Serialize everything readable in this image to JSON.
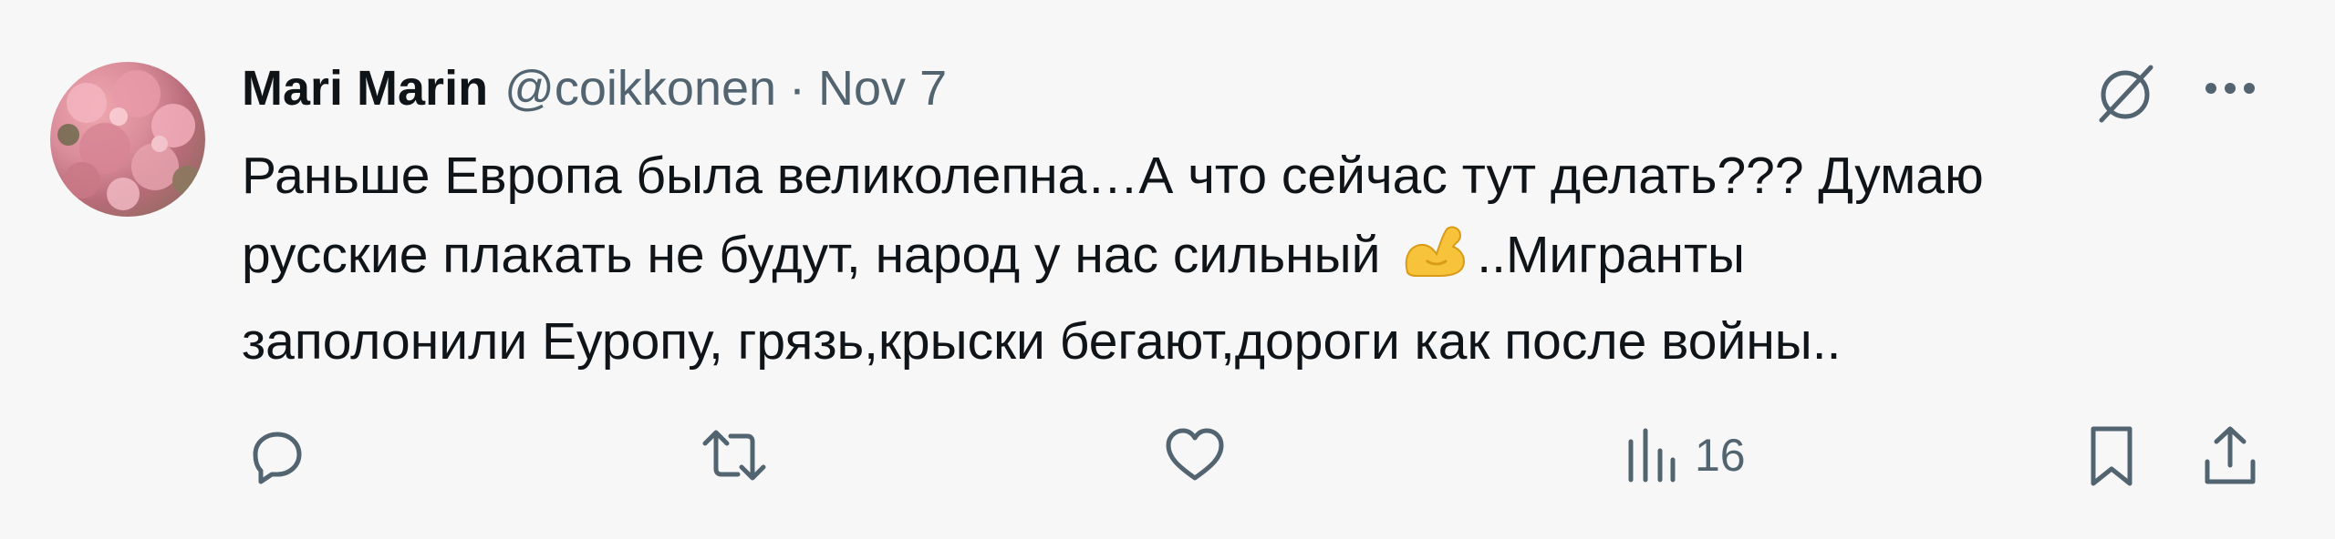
{
  "tweet": {
    "author_name": "Mari Marin",
    "handle": "@coikkonen",
    "separator": "·",
    "date": "Nov 7",
    "text_lines": {
      "l1": "Раньше Европа была великолепна…А что сейчас тут делать??? Думаю",
      "l2a": "русские плакать не будут, народ у нас сильный",
      "emoji": "flexed-biceps",
      "l2b": "..Мигранты",
      "l3": "заполонили Еуропу, грязь,крыски бегают,дороги как после войны.."
    },
    "actions": {
      "reply": {
        "icon": "reply-icon"
      },
      "retweet": {
        "icon": "retweet-icon"
      },
      "like": {
        "icon": "heart-icon"
      },
      "views": {
        "icon": "views-chart-icon",
        "count": "16"
      },
      "bookmark": {
        "icon": "bookmark-icon"
      },
      "share": {
        "icon": "share-icon"
      }
    },
    "top_icons": [
      "grok-icon",
      "more-icon"
    ]
  },
  "colors": {
    "background": "#f7f7f7",
    "text_primary": "#0f1419",
    "text_secondary": "#536471"
  }
}
